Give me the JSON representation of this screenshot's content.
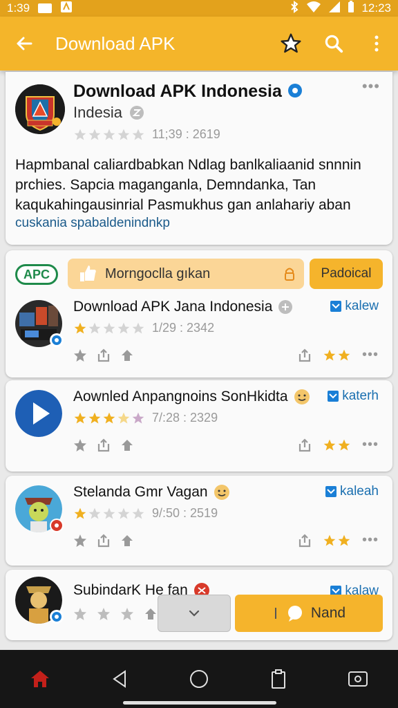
{
  "status_bar": {
    "time": "1:39",
    "clock": "12:23"
  },
  "app_bar": {
    "title": "Download APK"
  },
  "hero": {
    "app_name": "Download APK Indonesia",
    "developer": "Indesia",
    "rating_date": "11;39 : 2619",
    "description": "Hapmbanal caliardbabkan Ndlag banlkaliaanid snnnin prchies. Sapcia maganganla, Demndanka, Tan kaqukahingausinrial Pasmukhus gan anlahariy aban",
    "link_text": "cuskania spabaldenindnkp"
  },
  "promo": {
    "badge": "APC",
    "label": "Morngoclla gıkan",
    "button": "Padoical"
  },
  "list": [
    {
      "name": "Download APK Jana Indonesia",
      "rating_date": "1/29 : 2342",
      "kaleb": "kalew",
      "stars": 1
    },
    {
      "name": "Aownled Anpangnoins SonHkidta",
      "rating_date": "7/:28 : 2329",
      "kaleb": "katerh",
      "stars": 3.5
    },
    {
      "name": "Stelanda Gmr Vagan",
      "rating_date": "9/:50 : 2519",
      "kaleb": "kaleah",
      "stars": 1
    },
    {
      "name": "SubindarK He fan",
      "kaleb": "kalaw"
    }
  ],
  "bottom_controls": {
    "primary_label": "Nand"
  },
  "colors": {
    "accent": "#f4b52a",
    "status_bar": "#e3a21c",
    "link": "#1a5a8a",
    "star": "#f0b020"
  }
}
